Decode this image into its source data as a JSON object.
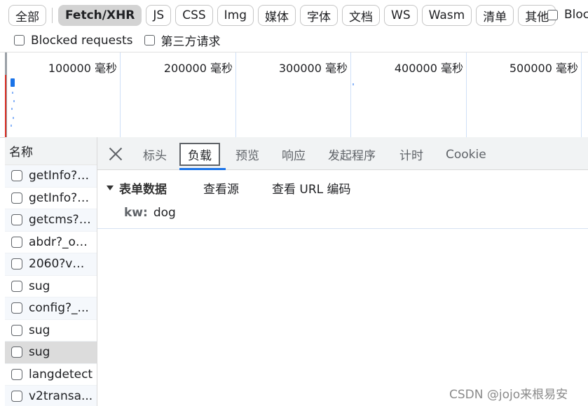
{
  "filters": {
    "chips": [
      {
        "label": "全部",
        "active": false
      },
      {
        "label": "Fetch/XHR",
        "active": true
      },
      {
        "label": "JS",
        "active": false
      },
      {
        "label": "CSS",
        "active": false
      },
      {
        "label": "Img",
        "active": false
      },
      {
        "label": "媒体",
        "active": false
      },
      {
        "label": "字体",
        "active": false
      },
      {
        "label": "文档",
        "active": false
      },
      {
        "label": "WS",
        "active": false
      },
      {
        "label": "Wasm",
        "active": false
      },
      {
        "label": "清单",
        "active": false
      },
      {
        "label": "其他",
        "active": false
      }
    ],
    "blocked_cookies_label": "Bloc",
    "blocked_requests_label": "Blocked requests",
    "third_party_label": "第三方请求"
  },
  "overview": {
    "ticks": [
      "100000 毫秒",
      "200000 毫秒",
      "300000 毫秒",
      "400000 毫秒",
      "500000 毫秒"
    ]
  },
  "requests": {
    "header": "名称",
    "items": [
      {
        "name": "getInfo?_...",
        "selected": false
      },
      {
        "name": "getInfo?_...",
        "selected": false
      },
      {
        "name": "getcms?_...",
        "selected": false
      },
      {
        "name": "abdr?_o=...",
        "selected": false
      },
      {
        "name": "2060?v=...",
        "selected": false
      },
      {
        "name": "sug",
        "selected": false
      },
      {
        "name": "config?_...",
        "selected": false
      },
      {
        "name": "sug",
        "selected": false
      },
      {
        "name": "sug",
        "selected": true
      },
      {
        "name": "langdetect",
        "selected": false
      },
      {
        "name": "v2transa...",
        "selected": false
      }
    ]
  },
  "details": {
    "tabs": {
      "headers": "标头",
      "payload": "负载",
      "preview": "预览",
      "response": "响应",
      "initiator": "发起程序",
      "timing": "计时",
      "cookies": "Cookie"
    },
    "form_data": {
      "title": "表单数据",
      "view_source": "查看源",
      "view_url_encoded": "查看 URL 编码",
      "key": "kw:",
      "value": "dog"
    }
  },
  "watermark": "CSDN @jojo来根易安"
}
